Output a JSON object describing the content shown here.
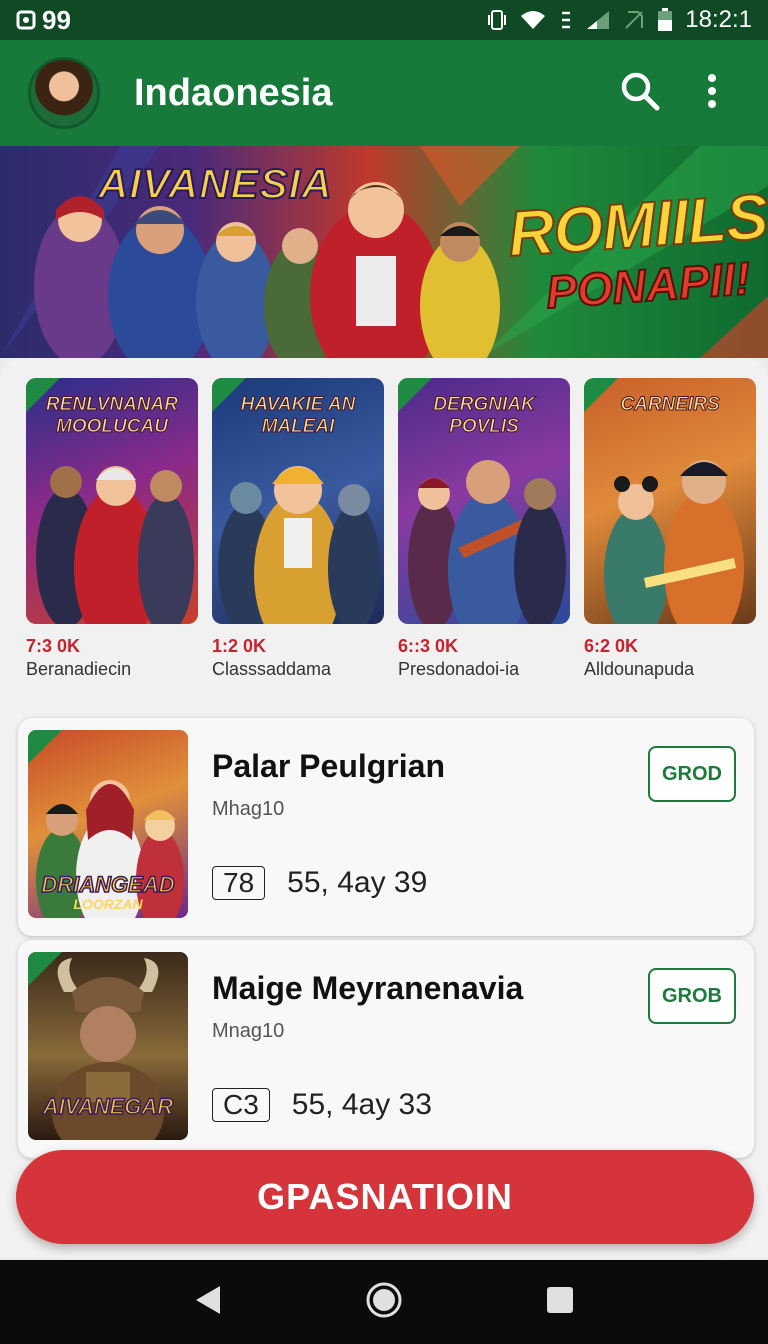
{
  "status_bar": {
    "left_text": "99",
    "time": "18:2:1"
  },
  "app_bar": {
    "title": "Indaonesia"
  },
  "banner": {
    "logo_text": "AIVANESIA",
    "promo_line1": "ROMIILS",
    "promo_line2": "PONAPII!"
  },
  "carousel": {
    "items": [
      {
        "poster_title": "RENLVNANAR MOOLUCAU",
        "stat": "7:3 0K",
        "name": "Beranadiecin"
      },
      {
        "poster_title": "HAVAKIE AN MALEAI",
        "stat": "1:2 0K",
        "name": "Classsaddama"
      },
      {
        "poster_title": "DERGNIAK POVLIS",
        "stat": "6::3 0K",
        "name": "Presdonadoi-ia"
      },
      {
        "poster_title": "CARNEIRS",
        "stat": "6:2 0K",
        "name": "Alldounapuda"
      }
    ]
  },
  "list": {
    "items": [
      {
        "image_text": "DRIANGEAD",
        "image_subtext": "LOORZAN",
        "title": "Palar Peulgrian",
        "subtitle": "Mhag10",
        "badge": "78",
        "meta": "55, 4ay 39",
        "button_label": "GROD"
      },
      {
        "image_text": "AIVANEGAR",
        "image_subtext": "",
        "title": "Maige Meyranenavia",
        "subtitle": "Mnag10",
        "badge": "C3",
        "meta": "55, 4ay 33",
        "button_label": "GROB"
      }
    ]
  },
  "cta": {
    "label": "GPASNATIOIN"
  },
  "colors": {
    "app_bar": "#177a3b",
    "status_bar": "#0f4a25",
    "accent_red": "#d6343b",
    "button_green": "#1d7a3c",
    "stat_red": "#c8232c"
  },
  "icons": {
    "status_left": "notification-icon",
    "status_right": [
      "vibrate-icon",
      "wifi-icon",
      "signal-icon",
      "battery-icon"
    ],
    "app_bar": [
      "search-icon",
      "more-vert-icon"
    ],
    "nav": [
      "back-icon",
      "home-icon",
      "recents-icon"
    ]
  }
}
